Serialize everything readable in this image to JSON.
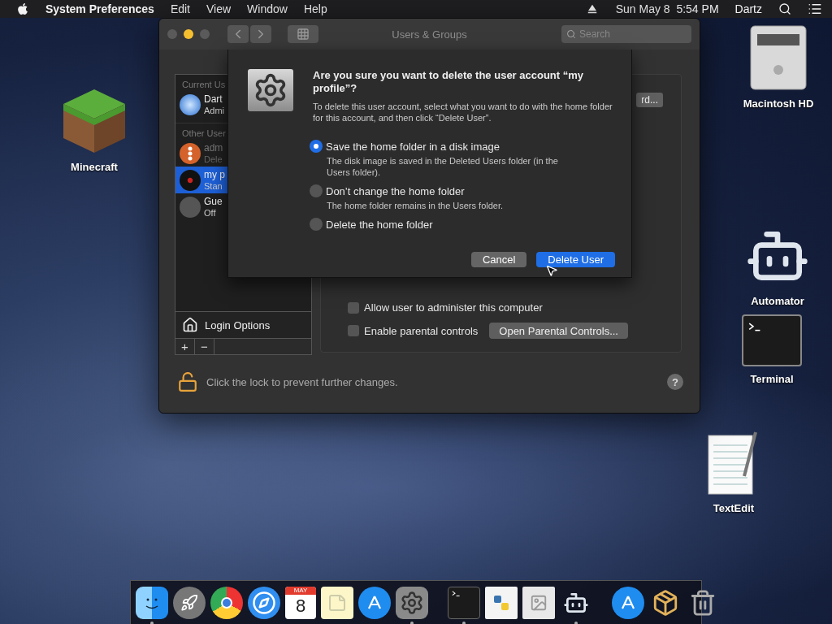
{
  "menubar": {
    "app": "System Preferences",
    "menus": [
      "Edit",
      "View",
      "Window",
      "Help"
    ],
    "clock": "Sun May 8  5:54 PM",
    "user": "Dartz"
  },
  "window": {
    "title": "Users & Groups",
    "search": {
      "placeholder": "Search"
    },
    "sidebar": {
      "sections": [
        {
          "header": "Current Us",
          "users": [
            {
              "name": "Dart",
              "role": "Admi",
              "selected": false,
              "dimmed": false,
              "kind": "snowflake"
            }
          ]
        },
        {
          "header": "Other User",
          "users": [
            {
              "name": "adm",
              "role": "Dele",
              "selected": false,
              "dimmed": true,
              "kind": "orange"
            },
            {
              "name": "my p",
              "role": "Stan",
              "selected": true,
              "dimmed": false,
              "kind": "dark"
            },
            {
              "name": "Gue",
              "role": "Off",
              "selected": false,
              "dimmed": false,
              "kind": "guest"
            }
          ]
        }
      ],
      "login_options": "Login Options",
      "add": "+",
      "remove": "−"
    },
    "partial_button": "rd...",
    "checkboxes": [
      {
        "label": "Allow user to administer this computer",
        "checked": false
      },
      {
        "label": "Enable parental controls",
        "checked": false
      }
    ],
    "parental_button": "Open Parental Controls...",
    "lock_text": "Click the lock to prevent further changes.",
    "help": "?"
  },
  "dialog": {
    "title": "Are you sure you want to delete the user account “my profile”?",
    "message": "To delete this user account, select what you want to do with the home folder for this account, and then click “Delete User”.",
    "options": [
      {
        "label": "Save the home folder in a disk image",
        "detail": "The disk image is saved in the Deleted Users folder (in the Users folder).",
        "selected": true
      },
      {
        "label": "Don’t change the home folder",
        "detail": "The home folder remains in the Users folder.",
        "selected": false
      },
      {
        "label": "Delete the home folder",
        "selected": false
      }
    ],
    "buttons": [
      {
        "label": "Cancel",
        "kind": "normal"
      },
      {
        "label": "Delete User",
        "kind": "default"
      }
    ]
  },
  "desktop_icons": [
    {
      "label": "Macintosh HD",
      "kind": "disk"
    },
    {
      "label": "Minecraft",
      "kind": "minecraft"
    },
    {
      "label": "Automator",
      "kind": "automator"
    },
    {
      "label": "Terminal",
      "kind": "terminal"
    },
    {
      "label": "TextEdit",
      "kind": "textedit"
    }
  ],
  "dock": [
    {
      "kind": "finder",
      "running": true
    },
    {
      "kind": "launchpad",
      "running": false
    },
    {
      "kind": "chrome",
      "running": false
    },
    {
      "kind": "safari",
      "running": false
    },
    {
      "kind": "calendar",
      "month": "MAY",
      "day": "8",
      "running": false
    },
    {
      "kind": "notes",
      "running": false
    },
    {
      "kind": "appstore",
      "running": false
    },
    {
      "kind": "sysprefs",
      "running": true
    },
    {
      "kind": "separator"
    },
    {
      "kind": "terminal",
      "running": true
    },
    {
      "kind": "python",
      "running": false
    },
    {
      "kind": "preview",
      "running": false
    },
    {
      "kind": "automator",
      "running": true
    },
    {
      "kind": "separator"
    },
    {
      "kind": "appstore",
      "running": false
    },
    {
      "kind": "package",
      "running": false
    },
    {
      "kind": "trash",
      "running": false
    }
  ]
}
